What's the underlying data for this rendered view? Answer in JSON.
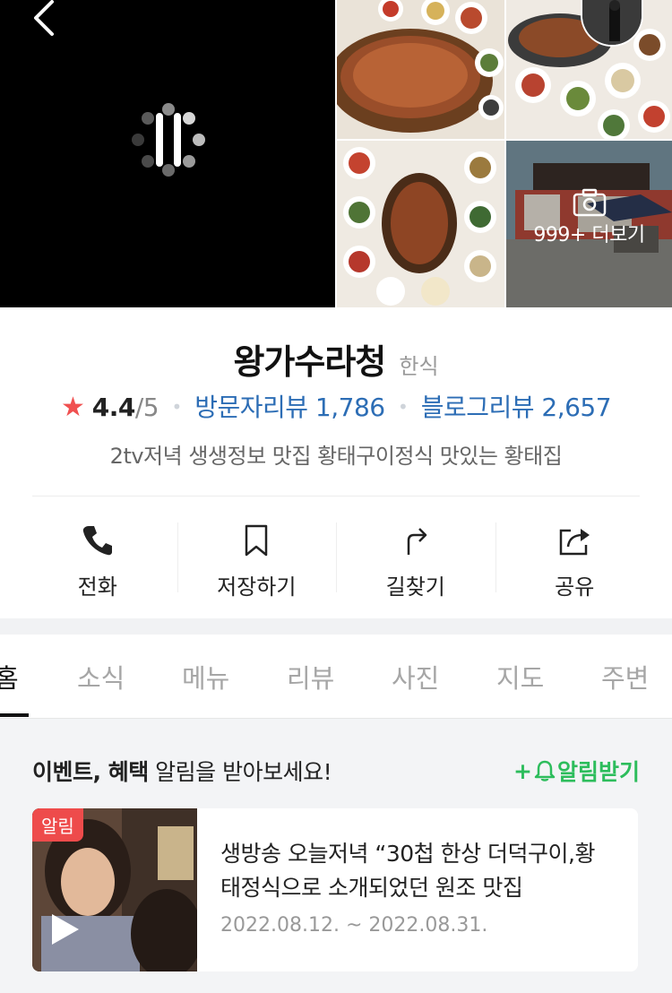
{
  "header": {
    "more_photos_label": "999+ 더보기"
  },
  "place": {
    "name": "왕가수라청",
    "category": "한식",
    "rating": "4.4",
    "rating_max": "/5",
    "visitor_reviews": "방문자리뷰 1,786",
    "blog_reviews": "블로그리뷰 2,657",
    "description": "2tv저녁 생생정보 맛집 황태구이정식 맛있는 황태집"
  },
  "actions": [
    {
      "label": "전화",
      "icon": "phone-icon"
    },
    {
      "label": "저장하기",
      "icon": "bookmark-icon"
    },
    {
      "label": "길찾기",
      "icon": "directions-icon"
    },
    {
      "label": "공유",
      "icon": "share-icon"
    }
  ],
  "tabs": [
    "홈",
    "소식",
    "메뉴",
    "리뷰",
    "사진",
    "지도",
    "주변"
  ],
  "active_tab": "홈",
  "event": {
    "heading_bold": "이벤트, 혜택",
    "heading_rest": " 알림을 받아보세요!",
    "subscribe_label": "알림받기",
    "card": {
      "badge": "알림",
      "title": "생방송 오늘저녁 “30첩 한상 더덕구이,황태정식으로 소개되었던 원조 맛집",
      "date": "2022.08.12. ~ 2022.08.31."
    }
  },
  "colors": {
    "accent_link": "#2c6db5",
    "star": "#f05050",
    "subscribe_green": "#2dbd5c",
    "badge_red": "#ee4b4b"
  }
}
